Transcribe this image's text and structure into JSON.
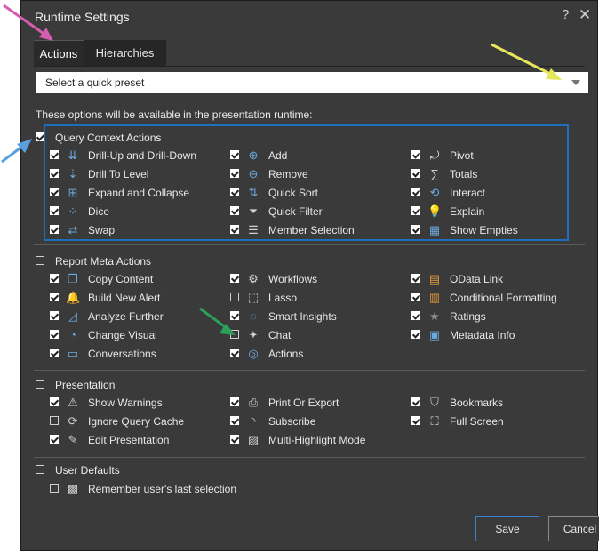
{
  "dialog": {
    "title": "Runtime Settings",
    "help": "?",
    "close": "✕"
  },
  "tabs": [
    {
      "label": "Actions",
      "active": true
    },
    {
      "label": "Hierarchies",
      "active": false
    }
  ],
  "preset": {
    "placeholder": "Select a quick preset"
  },
  "intro": "These options will be available in the presentation runtime:",
  "sections": {
    "query": {
      "label": "Query Context Actions",
      "checked": true,
      "items": [
        {
          "label": "Drill-Up and Drill-Down",
          "checked": true,
          "icon": "drill-icon"
        },
        {
          "label": "Drill To Level",
          "checked": true,
          "icon": "drill-to-level-icon"
        },
        {
          "label": "Expand and Collapse",
          "checked": true,
          "icon": "expand-collapse-icon"
        },
        {
          "label": "Dice",
          "checked": true,
          "icon": "dice-icon"
        },
        {
          "label": "Swap",
          "checked": true,
          "icon": "swap-icon"
        },
        {
          "label": "Add",
          "checked": true,
          "icon": "add-icon"
        },
        {
          "label": "Remove",
          "checked": true,
          "icon": "remove-icon"
        },
        {
          "label": "Quick Sort",
          "checked": true,
          "icon": "sort-icon"
        },
        {
          "label": "Quick Filter",
          "checked": true,
          "icon": "filter-icon"
        },
        {
          "label": "Member Selection",
          "checked": true,
          "icon": "member-selection-icon"
        },
        {
          "label": "Pivot",
          "checked": true,
          "icon": "pivot-icon"
        },
        {
          "label": "Totals",
          "checked": true,
          "icon": "sigma-icon"
        },
        {
          "label": "Interact",
          "checked": true,
          "icon": "interact-icon"
        },
        {
          "label": "Explain",
          "checked": true,
          "icon": "lightbulb-icon"
        },
        {
          "label": "Show Empties",
          "checked": true,
          "icon": "grid-icon"
        }
      ]
    },
    "meta": {
      "label": "Report Meta Actions",
      "checked": false,
      "items": [
        {
          "label": "Copy Content",
          "checked": true,
          "icon": "copy-icon"
        },
        {
          "label": "Build New Alert",
          "checked": true,
          "icon": "alert-icon"
        },
        {
          "label": "Analyze Further",
          "checked": true,
          "icon": "analyze-icon"
        },
        {
          "label": "Change Visual",
          "checked": true,
          "icon": "change-visual-icon"
        },
        {
          "label": "Conversations",
          "checked": true,
          "icon": "conversation-icon"
        },
        {
          "label": "Workflows",
          "checked": true,
          "icon": "workflow-icon"
        },
        {
          "label": "Lasso",
          "checked": false,
          "icon": "lasso-icon"
        },
        {
          "label": "Smart Insights",
          "checked": true,
          "icon": "smart-insights-icon"
        },
        {
          "label": "Chat",
          "checked": false,
          "icon": "chat-icon"
        },
        {
          "label": "Actions",
          "checked": true,
          "icon": "actions-icon"
        },
        {
          "label": "OData Link",
          "checked": true,
          "icon": "odata-icon"
        },
        {
          "label": "Conditional Formatting",
          "checked": true,
          "icon": "conditional-formatting-icon"
        },
        {
          "label": "Ratings",
          "checked": true,
          "icon": "ratings-icon"
        },
        {
          "label": "Metadata Info",
          "checked": true,
          "icon": "metadata-icon"
        }
      ]
    },
    "presentation": {
      "label": "Presentation",
      "checked": false,
      "items": [
        {
          "label": "Show Warnings",
          "checked": true,
          "icon": "warning-icon"
        },
        {
          "label": "Ignore Query Cache",
          "checked": false,
          "icon": "cache-icon"
        },
        {
          "label": "Edit Presentation",
          "checked": true,
          "icon": "pencil-icon"
        },
        {
          "label": "Print Or Export",
          "checked": true,
          "icon": "print-icon"
        },
        {
          "label": "Subscribe",
          "checked": true,
          "icon": "rss-icon"
        },
        {
          "label": "Multi-Highlight Mode",
          "checked": true,
          "icon": "highlight-icon"
        },
        {
          "label": "Bookmarks",
          "checked": true,
          "icon": "bookmark-icon"
        },
        {
          "label": "Full Screen",
          "checked": true,
          "icon": "fullscreen-icon"
        }
      ]
    },
    "user": {
      "label": "User Defaults",
      "checked": false,
      "items": [
        {
          "label": "Remember user's last selection",
          "checked": false,
          "icon": "save-user-icon"
        }
      ]
    }
  },
  "buttons": {
    "save": "Save",
    "cancel": "Cancel"
  },
  "colors": {
    "dialog_bg": "#3a3a3a",
    "accent_blue": "#1f6fbf",
    "arrow_pink": "#d45fb0",
    "arrow_yellow": "#e6e65a",
    "arrow_blue": "#5aa0e0",
    "arrow_green": "#2aa05a"
  }
}
